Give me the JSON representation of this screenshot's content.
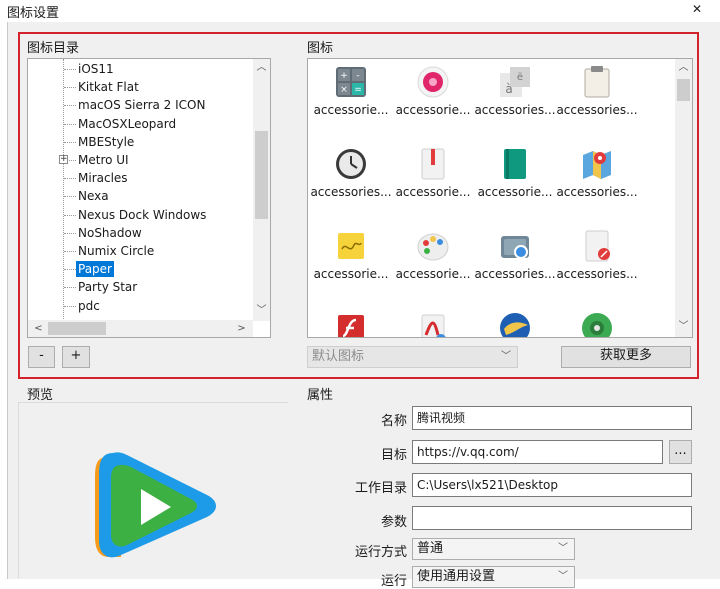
{
  "window": {
    "title": "图标设置",
    "close_glyph": "✕"
  },
  "icon_dir": {
    "label": "图标目录",
    "items": [
      {
        "label": "iOS11",
        "expandable": false,
        "selected": false
      },
      {
        "label": "Kitkat Flat",
        "expandable": false,
        "selected": false
      },
      {
        "label": "macOS Sierra 2 ICON",
        "expandable": false,
        "selected": false
      },
      {
        "label": "MacOSXLeopard",
        "expandable": false,
        "selected": false
      },
      {
        "label": "MBEStyle",
        "expandable": false,
        "selected": false
      },
      {
        "label": "Metro UI",
        "expandable": true,
        "selected": false
      },
      {
        "label": "Miracles",
        "expandable": false,
        "selected": false
      },
      {
        "label": "Nexa",
        "expandable": false,
        "selected": false
      },
      {
        "label": "Nexus Dock Windows",
        "expandable": false,
        "selected": false
      },
      {
        "label": "NoShadow",
        "expandable": false,
        "selected": false
      },
      {
        "label": "Numix Circle",
        "expandable": false,
        "selected": false
      },
      {
        "label": "Paper",
        "expandable": false,
        "selected": true
      },
      {
        "label": "Party Star",
        "expandable": false,
        "selected": false
      },
      {
        "label": "pdc",
        "expandable": false,
        "selected": false
      }
    ],
    "expander_glyph": "+",
    "remove_label": "-",
    "add_label": "+"
  },
  "icons": {
    "label": "图标",
    "items": [
      {
        "caption": "accessorie...",
        "icon": "calculator-icon"
      },
      {
        "caption": "accessorie...",
        "icon": "record-icon"
      },
      {
        "caption": "accessories...",
        "icon": "character-map-icon"
      },
      {
        "caption": "accessories...",
        "icon": "clipboard-icon"
      },
      {
        "caption": "accessories...",
        "icon": "clock-icon"
      },
      {
        "caption": "accessorie...",
        "icon": "notebook-icon"
      },
      {
        "caption": "accessorie...",
        "icon": "ebook-icon"
      },
      {
        "caption": "accessories...",
        "icon": "maps-icon"
      },
      {
        "caption": "accessorie...",
        "icon": "sticky-note-icon"
      },
      {
        "caption": "accessorie...",
        "icon": "palette-icon"
      },
      {
        "caption": "accessories...",
        "icon": "screenshot-icon"
      },
      {
        "caption": "accessories...",
        "icon": "text-editor-icon"
      },
      {
        "caption": "",
        "icon": "flash-icon"
      },
      {
        "caption": "",
        "icon": "pdf-icon"
      },
      {
        "caption": "",
        "icon": "bird-icon"
      },
      {
        "caption": "",
        "icon": "green-app-icon"
      }
    ],
    "default_select": "默认图标",
    "get_more_label": "获取更多"
  },
  "preview": {
    "label": "预览"
  },
  "properties": {
    "label": "属性",
    "name_label": "名称",
    "name_value": "腾讯视频",
    "target_label": "目标",
    "target_value": "https://v.qq.com/",
    "browse_label": "...",
    "workdir_label": "工作目录",
    "workdir_value": "C:\\Users\\lx521\\Desktop",
    "args_label": "参数",
    "args_value": "",
    "runmode_label": "运行方式",
    "runmode_value": "普通",
    "run_label": "运行",
    "run_value": "使用通用设置"
  },
  "colors": {
    "selection": "#0078d7",
    "highlight_frame": "#d3222a",
    "tencent_video_green": "#3cb043",
    "tencent_video_blue": "#1e9be8",
    "tencent_video_orange": "#f59a1b"
  }
}
